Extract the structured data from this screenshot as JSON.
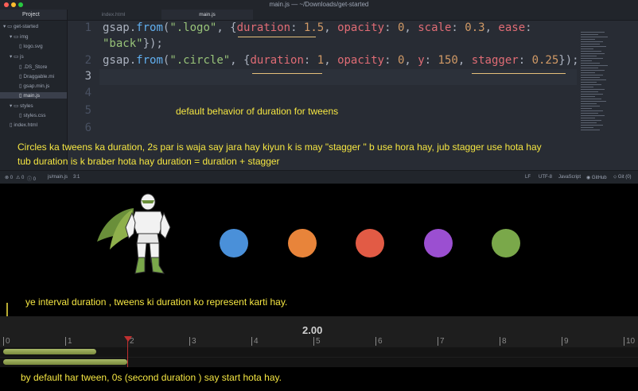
{
  "window": {
    "title": "main.js — ~/Downloads/get-started"
  },
  "sidebar": {
    "header": "Project",
    "items": [
      {
        "label": "get-started",
        "kind": "folder"
      },
      {
        "label": "img",
        "kind": "folder"
      },
      {
        "label": "logo.svg",
        "kind": "file"
      },
      {
        "label": "js",
        "kind": "folder"
      },
      {
        "label": ".DS_Store",
        "kind": "file"
      },
      {
        "label": "Draggable.mi",
        "kind": "file"
      },
      {
        "label": "gsap.min.js",
        "kind": "file"
      },
      {
        "label": "main.js",
        "kind": "file",
        "selected": true
      },
      {
        "label": "styles",
        "kind": "folder"
      },
      {
        "label": "styles.css",
        "kind": "file"
      },
      {
        "label": "index.html",
        "kind": "file"
      }
    ]
  },
  "tabs": [
    {
      "label": "index.html",
      "active": false
    },
    {
      "label": "main.js",
      "active": true
    }
  ],
  "code": {
    "line_numbers": [
      "1",
      "2",
      "3",
      "4",
      "5",
      "6"
    ],
    "line1a": {
      "t1": "gsap",
      "t2": ".",
      "t3": "from",
      "t4": "(",
      "t5": "\".logo\"",
      "t6": ", {",
      "t7": "duration",
      "t8": ": ",
      "t9": "1.5",
      "t10": ", ",
      "t11": "opacity",
      "t12": ": ",
      "t13": "0",
      "t14": ", ",
      "t15": "scale",
      "t16": ": ",
      "t17": "0.3",
      "t18": ", ",
      "t19": "ease",
      "t20": ":"
    },
    "line1b": {
      "t1": "\"back\"",
      "t2": "});"
    },
    "line2": {
      "t1": "gsap",
      "t2": ".",
      "t3": "from",
      "t4": "(",
      "t5": "\".circle\"",
      "t6": ", {",
      "t7": "duration",
      "t8": ": ",
      "t9": "1",
      "t10": ", ",
      "t11": "opacity",
      "t12": ": ",
      "t13": "0",
      "t14": ", ",
      "t15": "y",
      "t16": ": ",
      "t17": "150",
      "t18": ", ",
      "t19": "stagger",
      "t20": ": ",
      "t21": "0.25",
      "t22": "});"
    }
  },
  "statusbar": {
    "errors": "0",
    "warnings": "0",
    "infos": "0",
    "file": "js/main.js",
    "cursor": "3:1",
    "line_ending": "LF",
    "encoding": "UTF-8",
    "grammar": "JavaScript",
    "github": "GitHub",
    "git": "Git (0)"
  },
  "annotations": {
    "a1": "default behavior of duration for tweens",
    "a2": "Circles ka tweens ka duration, 2s par is waja say jara hay kiyun k is may \"stagger \" b use hora hay, jub stagger use hota hay",
    "a3": "tub  duration  is k braber hota hay  duration = duration + stagger",
    "a4": "ye interval duration , tweens ki duration ko represent karti hay.",
    "a5": "by default har tween, 0s (second  duration )  say start hota hay."
  },
  "stage": {
    "circle_colors": [
      "#4a90d9",
      "#e8843a",
      "#e25b45",
      "#9b4fd1",
      "#7aa84a"
    ]
  },
  "timeline": {
    "current_time": "2.00",
    "ticks": [
      "0",
      "1",
      "2",
      "3",
      "4",
      "5",
      "6",
      "7",
      "8",
      "9",
      "10"
    ],
    "tweens": [
      {
        "start": 0,
        "duration": 1.5
      },
      {
        "start": 0,
        "duration": 2.0
      }
    ],
    "playhead": 2.0
  },
  "colors": {
    "annotation": "#f5e642",
    "playhead": "#c03030",
    "bar": "#9aaa55"
  }
}
